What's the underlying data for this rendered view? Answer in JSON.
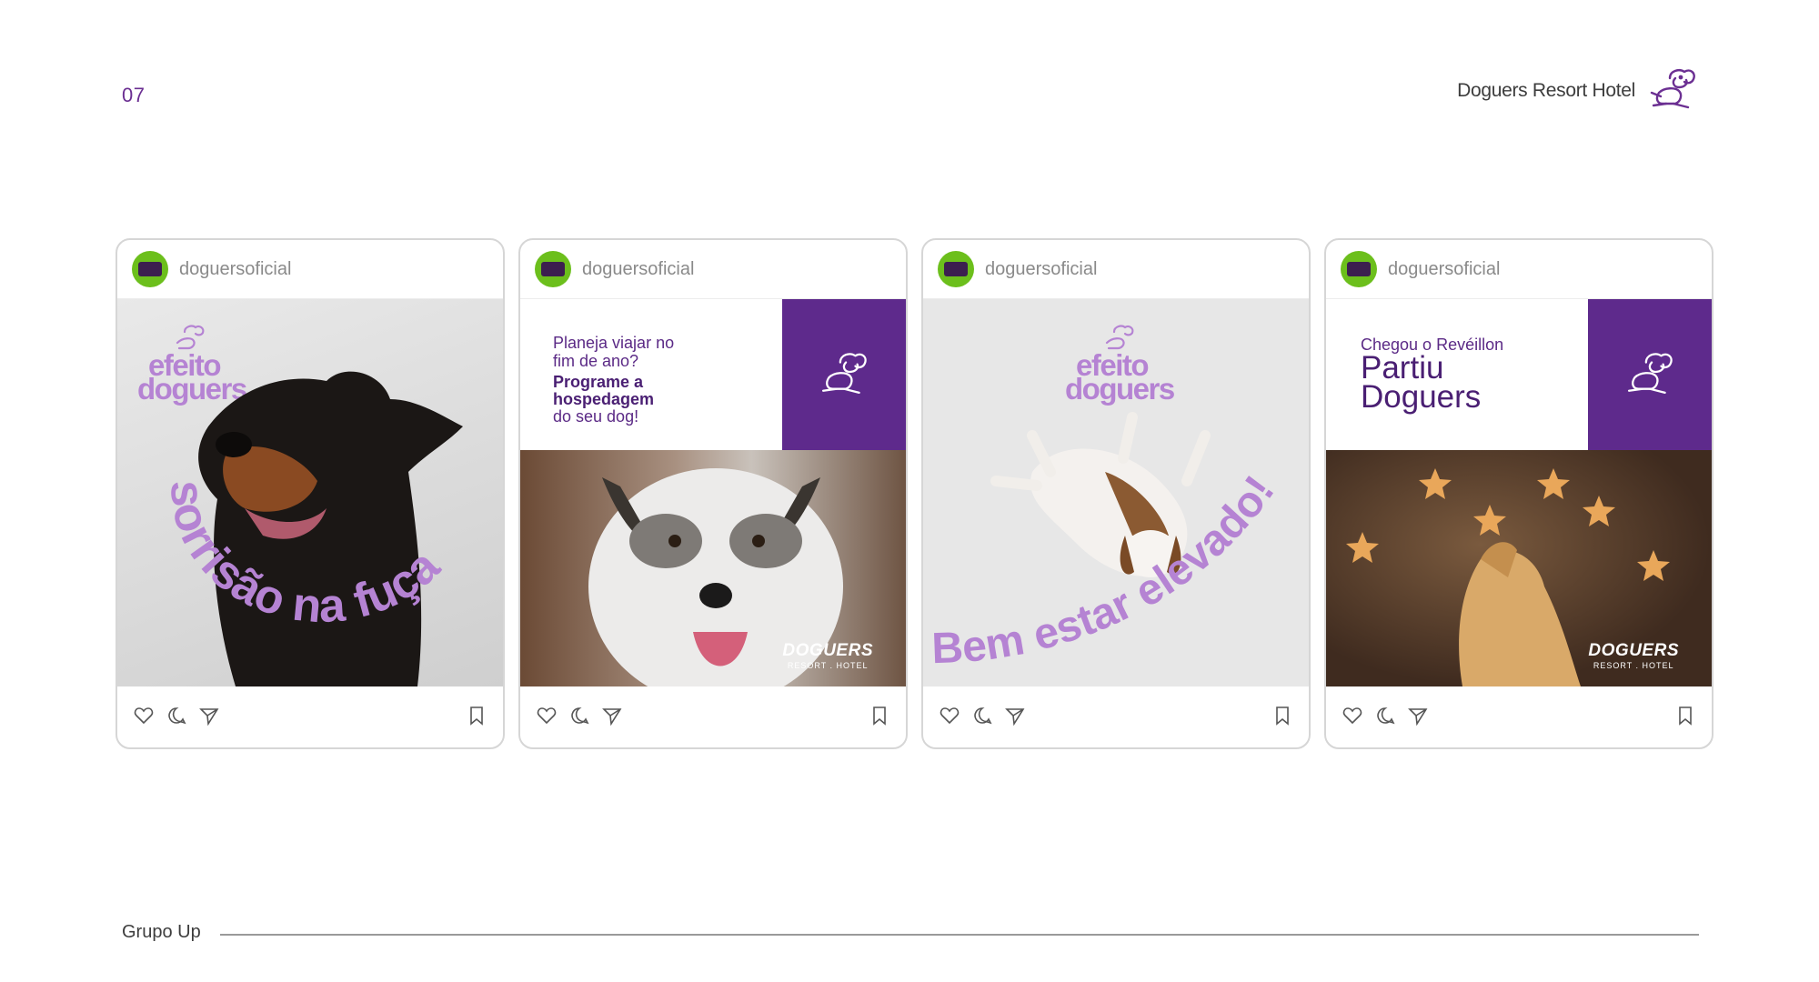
{
  "page": {
    "number": "07",
    "brand_name": "Doguers Resort Hotel",
    "footer_label": "Grupo Up"
  },
  "posts": [
    {
      "username": "doguersoficial",
      "logo_line1": "efeito",
      "logo_line2": "doguers",
      "curved_text": "sorrisão na fuça"
    },
    {
      "username": "doguersoficial",
      "text_intro": "Planeja viajar no fim de ano?",
      "text_bold": "Programe a hospedagem",
      "text_tail": "do seu dog!",
      "watermark_title": "DOGUERS",
      "watermark_sub": "RESORT . HOTEL"
    },
    {
      "username": "doguersoficial",
      "logo_line1": "efeito",
      "logo_line2": "doguers",
      "curved_text": "Bem estar elevado!"
    },
    {
      "username": "doguersoficial",
      "text_small": "Chegou o Revéillon",
      "text_big": "Partiu Doguers",
      "watermark_title": "DOGUERS",
      "watermark_sub": "RESORT . HOTEL"
    }
  ],
  "colors": {
    "brand_purple": "#5e2a8c",
    "soft_purple": "#b583d3",
    "avatar_green": "#6cbf1c",
    "card_border": "#d6d6d6"
  },
  "icons": [
    "heart-icon",
    "comment-icon",
    "share-icon",
    "bookmark-icon",
    "dog-logo-icon"
  ]
}
